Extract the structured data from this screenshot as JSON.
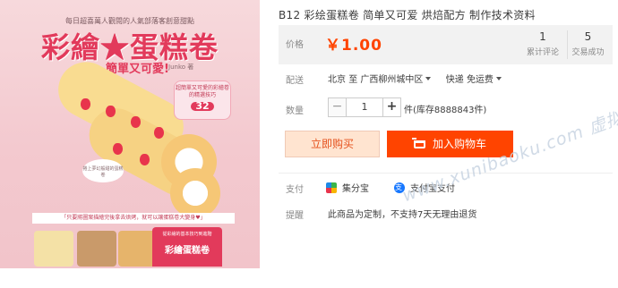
{
  "cover": {
    "top_text": "每日超喜萬人觀閱的人氣部落客創意甜點",
    "title": "彩繪★蛋糕卷",
    "subtitle": "簡單又可愛!",
    "author": "Junko 著",
    "badge_text": "超簡單又可愛的彩繪卷的精選技巧",
    "badge_count": "32",
    "note_text": "捲上夢幻般甜的蛋糕卷",
    "bar_text": "「只要將圖案描繪完後拿去烘烤，就可以讓蛋糕卷大變身♥」",
    "foot_small": "從彩繪的基本技巧到進階",
    "foot_title": "彩繪蛋糕卷"
  },
  "product": {
    "title": "B12 彩绘蛋糕卷 简单又可爱 烘焙配方 制作技术资料"
  },
  "price": {
    "label": "价格",
    "value": "￥1.00",
    "reviews_count": "1",
    "reviews_label": "累计评论",
    "sales_count": "5",
    "sales_label": "交易成功"
  },
  "shipping": {
    "label": "配送",
    "origin": "北京",
    "to": "至",
    "destination": "广西柳州城中区",
    "method": "快递",
    "fee": "免运费"
  },
  "quantity": {
    "label": "数量",
    "minus": "−",
    "value": "1",
    "plus": "+",
    "stock": "件(库存8888843件)"
  },
  "actions": {
    "buy_now": "立即购买",
    "add_to_cart": "加入购物车"
  },
  "payment": {
    "label": "支付",
    "method1": "集分宝",
    "method2": "支付宝支付"
  },
  "notice": {
    "label": "提醒",
    "text": "此商品为定制，不支持7天无理由退货"
  },
  "watermark": "www.xunibaoku.com  虚拟宝库网",
  "colors": {
    "accent": "#ff4400",
    "buy_now_bg": "#ffe4d0",
    "price_bg": "#f2f2f2"
  }
}
